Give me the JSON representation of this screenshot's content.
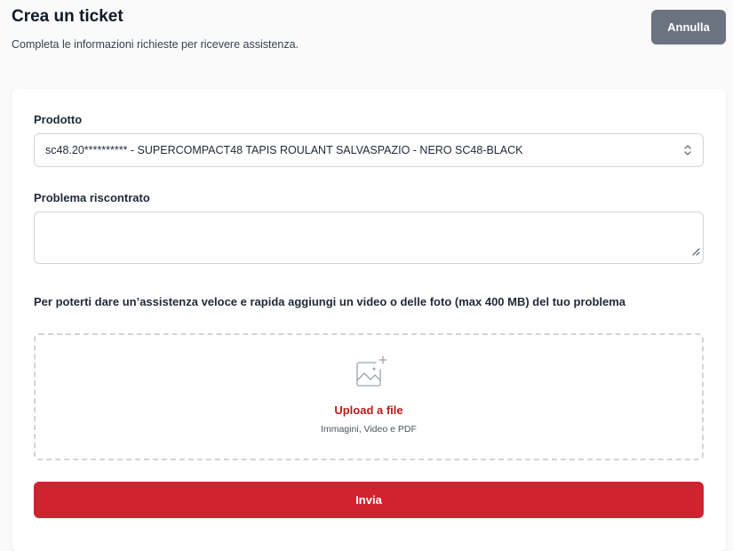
{
  "header": {
    "title": "Crea un ticket",
    "subtitle": "Completa le informazioni richieste per ricevere assistenza.",
    "cancel_label": "Annulla"
  },
  "form": {
    "product_label": "Prodotto",
    "product_value": "sc48.20********** - SUPERCOMPACT48 TAPIS ROULANT SALVASPAZIO - NERO SC48-BLACK",
    "problem_label": "Problema riscontrato",
    "problem_value": "",
    "upload_hint": "Per poterti dare un’assistenza veloce e rapida aggiungi un video o delle foto (max 400 MB) del tuo problema",
    "upload_link": "Upload a file",
    "upload_subtext": "Immagini, Video e PDF",
    "submit_label": "Invia"
  },
  "icons": {
    "select": "chevron-up-down-icon",
    "upload": "image-add-icon",
    "resize": "resize-grip-icon"
  },
  "colors": {
    "accent": "#d1222f",
    "link": "#b91c1c",
    "secondary_button": "#6b7280"
  }
}
